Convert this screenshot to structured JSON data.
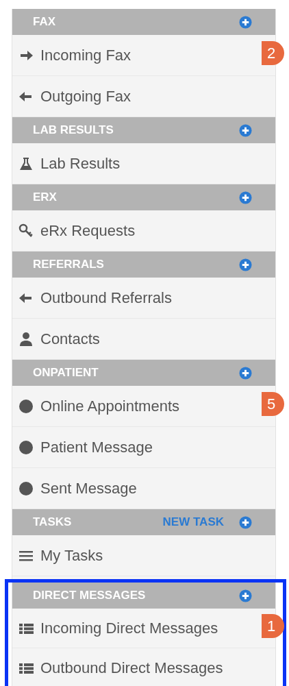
{
  "sections": [
    {
      "title": "FAX",
      "highlighted": false,
      "items": [
        {
          "kind": "arrow-right",
          "label": "Incoming Fax",
          "badge": "2"
        },
        {
          "kind": "arrow-left",
          "label": "Outgoing Fax"
        }
      ]
    },
    {
      "title": "LAB RESULTS",
      "highlighted": false,
      "items": [
        {
          "kind": "flask",
          "label": "Lab Results"
        }
      ]
    },
    {
      "title": "ERX",
      "highlighted": false,
      "items": [
        {
          "kind": "key",
          "label": "eRx Requests"
        }
      ]
    },
    {
      "title": "REFERRALS",
      "highlighted": false,
      "items": [
        {
          "kind": "arrow-left",
          "label": "Outbound Referrals"
        },
        {
          "kind": "user",
          "label": "Contacts"
        }
      ]
    },
    {
      "title": "ONPATIENT",
      "highlighted": false,
      "items": [
        {
          "kind": "circle",
          "label": "Online Appointments",
          "badge": "5"
        },
        {
          "kind": "circle",
          "label": "Patient Message"
        },
        {
          "kind": "circle",
          "label": "Sent Message"
        }
      ]
    },
    {
      "title": "TASKS",
      "action": "NEW TASK",
      "highlighted": false,
      "items": [
        {
          "kind": "bars",
          "label": "My Tasks"
        }
      ]
    },
    {
      "title": "DIRECT MESSAGES",
      "highlighted": true,
      "items": [
        {
          "kind": "list",
          "label": "Incoming Direct Messages",
          "badge": "1"
        },
        {
          "kind": "list",
          "label": "Outbound Direct Messages"
        }
      ]
    }
  ]
}
